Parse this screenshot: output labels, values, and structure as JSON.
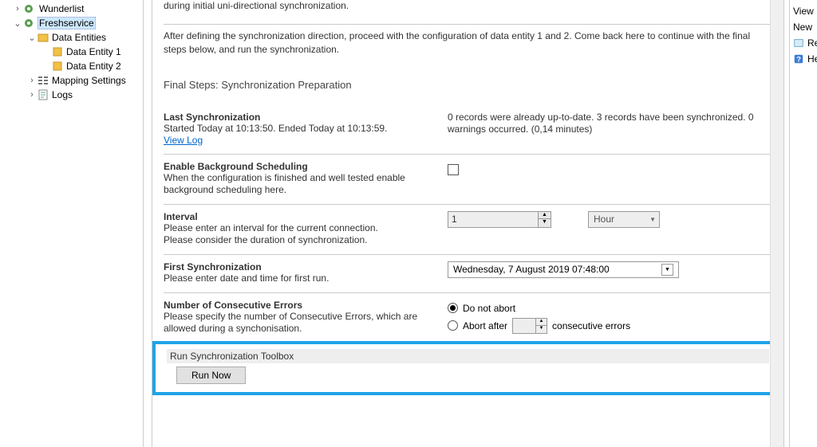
{
  "tree": {
    "item0": "Wunderlist",
    "item1": "Freshservice",
    "item2": "Data Entities",
    "item3": "Data Entity 1",
    "item4": "Data Entity 2",
    "item5": "Mapping Settings",
    "item6": "Logs"
  },
  "main": {
    "clip_text": "during initial uni-directional synchronization.",
    "help": "After defining the synchronization direction, proceed with the configuration of data entity 1 and 2. Come back here to continue with the final steps below, and run the synchronization.",
    "final_heading": "Final Steps: Synchronization Preparation",
    "last_sync": {
      "label": "Last Synchronization",
      "desc": "Started  Today at 10:13:50. Ended Today at 10:13:59.",
      "link": "View Log",
      "status": "0 records were already up-to-date. 3 records have been synchronized. 0 warnings occurred. (0,14 minutes)"
    },
    "bg_sched": {
      "label": "Enable Background Scheduling",
      "desc": "When the configuration is finished and well tested enable background scheduling here."
    },
    "interval": {
      "label": "Interval",
      "desc1": "Please enter an interval for the current connection.",
      "desc2": "Please consider the duration of synchronization.",
      "value": "1",
      "unit": "Hour"
    },
    "first_sync": {
      "label": "First Synchronization",
      "desc": "Please enter date and time for first run.",
      "value": "Wednesday,   7    August    2019 07:48:00"
    },
    "errors": {
      "label": "Number of Consecutive Errors",
      "desc": "Please specify the number of Consecutive Errors, which are allowed during a synchonisation.",
      "opt1": "Do not abort",
      "opt2_prefix": "Abort after",
      "opt2_suffix": "consecutive errors"
    },
    "run": {
      "heading": "Run Synchronization Toolbox",
      "button": "Run Now"
    }
  },
  "right": {
    "item0": "View",
    "item1": "New",
    "item2": "Rename",
    "item3": "Help"
  }
}
